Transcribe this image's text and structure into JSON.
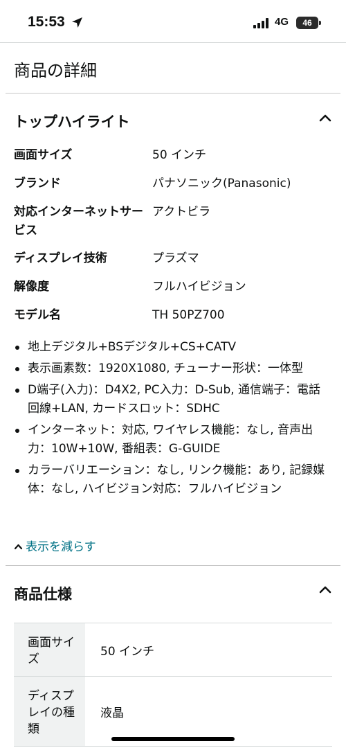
{
  "status_bar": {
    "time": "15:53",
    "network": "4G",
    "battery": "46"
  },
  "page": {
    "title": "商品の詳細"
  },
  "highlights": {
    "title": "トップハイライト",
    "specs": [
      {
        "key": "画面サイズ",
        "value": "50 インチ"
      },
      {
        "key": "ブランド",
        "value": "パナソニック(Panasonic)"
      },
      {
        "key": "対応インターネットサービス",
        "value": "アクトビラ"
      },
      {
        "key": "ディスプレイ技術",
        "value": "プラズマ"
      },
      {
        "key": "解像度",
        "value": "フルハイビジョン"
      },
      {
        "key": "モデル名",
        "value": "TH 50PZ700"
      }
    ],
    "bullets": [
      "地上デジタル+BSデジタル+CS+CATV",
      "表示画素数：1920X1080, チューナー形状：一体型",
      "D端子(入力)：D4X2, PC入力：D-Sub, 通信端子：電話回線+LAN, カードスロット：SDHC",
      "インターネット：対応, ワイヤレス機能：なし, 音声出力：10W+10W, 番組表：G-GUIDE",
      "カラーバリエーション：なし, リンク機能：あり, 記録媒体：なし, ハイビジョン対応：フルハイビジョン"
    ],
    "collapse_label": "表示を減らす"
  },
  "specifications": {
    "title": "商品仕様",
    "rows": [
      {
        "key": "画面サイズ",
        "value": "50 インチ"
      },
      {
        "key": "ディスプレイの種類",
        "value": "液晶"
      }
    ]
  }
}
